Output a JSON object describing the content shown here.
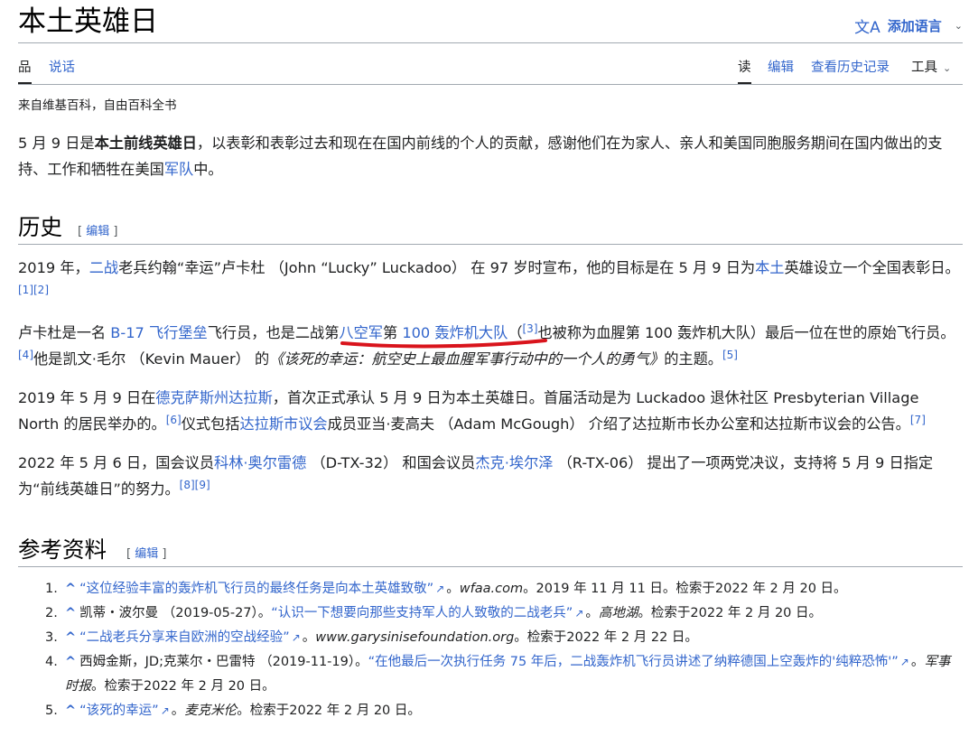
{
  "page": {
    "title": "本土英雄日"
  },
  "language": {
    "icon": "translate-icon",
    "label": "添加语言"
  },
  "tabs": {
    "article": "品",
    "talk": "说话",
    "read": "读",
    "edit": "编辑",
    "history": "查看历史记录",
    "tools": "工具"
  },
  "tagline": "来自维基百科，自由百科全书",
  "intro": {
    "t1": "5 月 9 日是",
    "bold": "本土前线英雄日",
    "t2": "，以表彰和表彰过去和现在在国内前线的个人的贡献，感谢他们在为家人、亲人和美国同胞服务期间在国内做出的支持、工作和牺牲在美国",
    "link": "军队",
    "t3": "中。"
  },
  "sections": {
    "history": "历史",
    "references": "参考资料",
    "edit_open": "[ ",
    "edit_label": "编辑",
    "edit_close": " ]"
  },
  "history": {
    "p1": {
      "t1": "2019 年，",
      "l1": "二战",
      "t2": "老兵约翰“幸运”卢卡杜 （John “Lucky” Luckadoo） 在 97 岁时宣布，他的目标是在 5 月 9 日为",
      "l2": "本土",
      "t3": "英雄设立一个全国表彰日。",
      "c1": "[1]",
      "c2": "[2]"
    },
    "p2": {
      "t1": "卢卡杜是一名 ",
      "l1": "B-17 飞行堡垒",
      "t2": "飞行员，也是二战",
      "l2": "第",
      "l3": "八空军",
      "t3": "第 ",
      "l4": "100 轰炸机大队",
      "t4": "（",
      "c1": "[3]",
      "t5": "也被称为血腥第 100 轰炸机大队）最后一位在世的原始飞行员。",
      "c2": "[4]",
      "t6": "他是凯文·毛尔 （Kevin Mauer） 的",
      "i1": "《该死的幸运：航空史上最血腥军事行动中的一个人的勇气》",
      "t7": "的主题。",
      "c3": "[5]"
    },
    "p3": {
      "t1": "2019 年 5 月 9 日在",
      "l1": "德克萨斯州达拉斯",
      "t2": "，首次正式承认 5 月 9 日为本土英雄日。首届活动是为 Luckadoo 退休社区 Presbyterian Village North 的居民举办的。",
      "c1": "[6]",
      "t3": "仪式包括",
      "l2": "达拉斯市议会",
      "t4": "成员亚当·麦高夫 （Adam McGough） 介绍了达拉斯市长办公室和达拉斯市议会的公告。",
      "c2": "[7]"
    },
    "p4": {
      "t1": "2022 年 5 月 6 日，国会议员",
      "l1": "科林·奥尔雷德",
      "t2": " （D-TX-32） 和国会议员",
      "l2": "杰克·埃尔泽",
      "t3": " （R-TX-06） 提出了一项两党决议，支持将 5 月 9 日指定为“前线英雄日”的努力。",
      "c1": "[8]",
      "c2": "[9]"
    }
  },
  "references": [
    {
      "num": "1.",
      "pre": "",
      "link": "“这位经验丰富的轰炸机飞行员的最终任务是向本土英雄致敬”",
      "mid": "。",
      "italic": "wfaa.com",
      "post": "。2019 年 11 月 11 日。检索于2022 年 2 月 20 日。"
    },
    {
      "num": "2.",
      "pre": "凯蒂・波尔曼 （2019-05-27）。",
      "link": "“认识一下想要向那些支持军人的人致敬的二战老兵”",
      "mid": "。",
      "italic": "高地湖",
      "post": "。检索于2022 年 2 月 20 日。"
    },
    {
      "num": "3.",
      "pre": "",
      "link": "“二战老兵分享来自欧洲的空战经验”",
      "mid": "。",
      "italic": "www.garysinisefoundation.org",
      "post": "。检索于2022 年 2 月 22 日。"
    },
    {
      "num": "4.",
      "pre": "西姆金斯，JD;克莱尔・巴雷特 （2019-11-19）。",
      "link": "“在他最后一次执行任务 75 年后，二战轰炸机飞行员讲述了纳粹德国上空轰炸的'纯粹恐怖'”",
      "mid": "。",
      "italic": "军事时报",
      "post": "。检索于2022 年 2 月 20 日。"
    },
    {
      "num": "5.",
      "pre": "",
      "link": "“该死的幸运”",
      "mid": "。",
      "italic": "麦克米伦",
      "post": "。检索于2022 年 2 月 20 日。"
    }
  ],
  "ref_caret": "^",
  "ext_icon": "↗",
  "annotation_color": "#d9141c"
}
